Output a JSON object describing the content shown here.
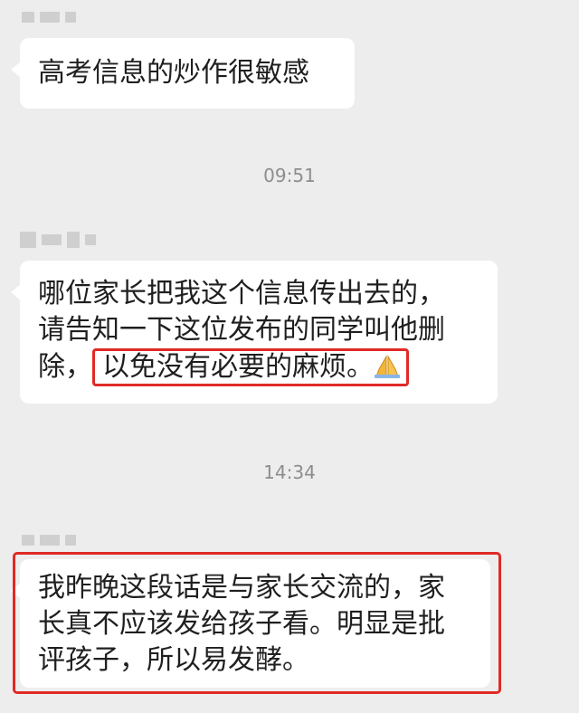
{
  "messages": [
    {
      "lines": [
        "高考信息的炒作很敏感"
      ]
    },
    {
      "lines": [
        "哪位家长把我这个信息传出去的，",
        "请告知一下这位发布的同学叫他删"
      ],
      "line3_prefix": "除，",
      "highlight": "以免没有必要的麻烦。"
    },
    {
      "lines": [
        "我昨晚这段话是与家长交流的，家",
        "长真不应该发给孩子看。明显是批",
        "评孩子，所以易发酵。"
      ]
    }
  ],
  "timestamps": [
    "09:51",
    "14:34"
  ],
  "icons": {
    "praying_hands": "praying-hands-icon"
  },
  "colors": {
    "background": "#ededed",
    "bubble": "#ffffff",
    "highlight": "#e02a25",
    "timestamp": "#8d8d8d"
  }
}
